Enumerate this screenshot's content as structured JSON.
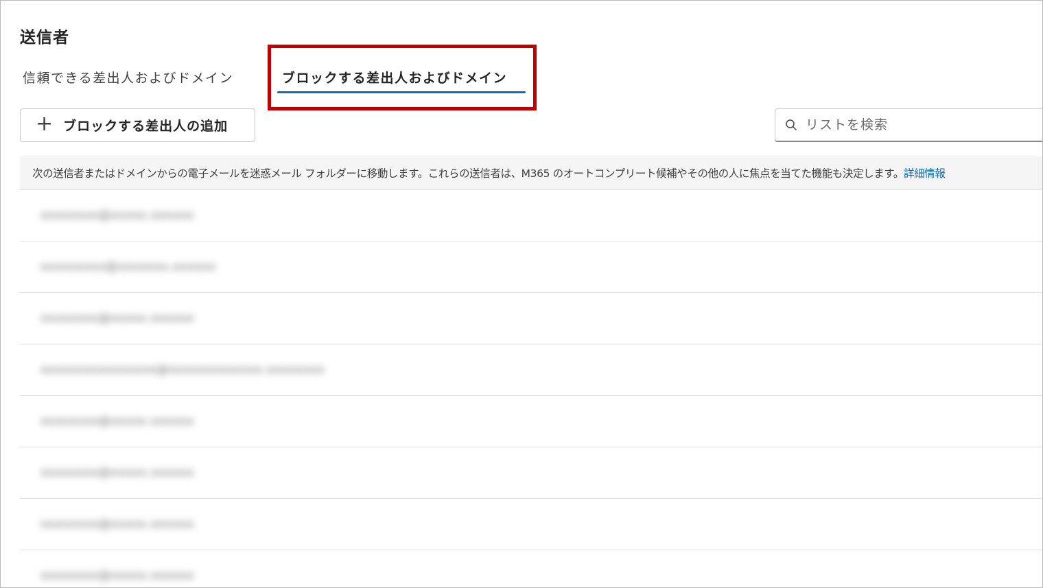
{
  "page": {
    "title": "送信者"
  },
  "tabs": [
    {
      "label": "信頼できる差出人およびドメイン",
      "selected": false
    },
    {
      "label": "ブロックする差出人およびドメイン",
      "selected": true
    }
  ],
  "toolbar": {
    "add_icon": "plus-icon",
    "add_label": "ブロックする差出人の追加"
  },
  "search": {
    "icon": "search-icon",
    "placeholder": "リストを検索"
  },
  "info": {
    "message": "次の送信者またはドメインからの電子メールを迷惑メール フォルダーに移動します。これらの送信者は、M365 のオートコンプリート候補やその他の人に焦点を当てた機能も決定します。",
    "link_label": "詳細情報"
  },
  "list": {
    "items": [
      {
        "address": "xxxxxxxx@xxxxx.xxxxxx"
      },
      {
        "address": "xxxxxxxxx@xxxxxxx.xxxxxx"
      },
      {
        "address": "xxxxxxxx@xxxxx.xxxxxx"
      },
      {
        "address": "xxxxxxxxxxxxxxxx@xxxxxxxxxxxxx.xxxxxxxx"
      },
      {
        "address": "xxxxxxxx@xxxxx.xxxxxx"
      },
      {
        "address": "xxxxxxxx@xxxxx.xxxxxx"
      },
      {
        "address": "xxxxxxxx@xxxxx.xxxxxx"
      },
      {
        "address": "xxxxxxxx@xxxxx.xxxxxx"
      }
    ]
  },
  "colors": {
    "accent": "#0f6cbd",
    "highlight": "#c00000"
  }
}
